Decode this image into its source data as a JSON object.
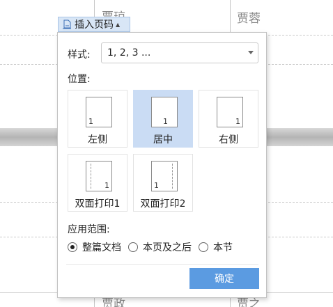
{
  "background": {
    "cells": [
      "贾琼",
      "贾蓉",
      "贾政",
      "贾之"
    ]
  },
  "insert_button": {
    "label": "插入页码",
    "icon": "page-number-icon"
  },
  "panel": {
    "style_label": "样式:",
    "style_value": "1, 2, 3 ...",
    "position_label": "位置:",
    "positions": [
      {
        "label": "左侧",
        "num": "1",
        "selected": false
      },
      {
        "label": "居中",
        "num": "1",
        "selected": true
      },
      {
        "label": "右侧",
        "num": "1",
        "selected": false
      },
      {
        "label": "双面打印1",
        "num": "1",
        "selected": false
      },
      {
        "label": "双面打印2",
        "num": "1",
        "selected": false
      }
    ],
    "scope_label": "应用范围:",
    "scope_options": [
      "整篇文档",
      "本页及之后",
      "本节"
    ],
    "scope_selected": "整篇文档",
    "ok_label": "确定"
  },
  "colors": {
    "accent": "#5b9be1",
    "selected_bg": "#cadcf4"
  }
}
